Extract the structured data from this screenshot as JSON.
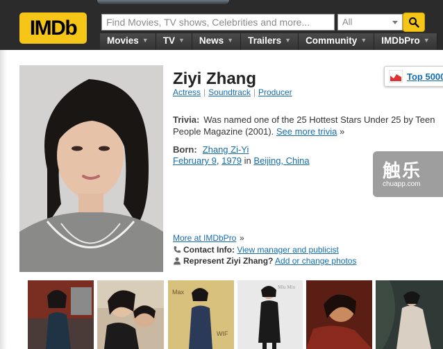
{
  "header": {
    "logo_text": "IMDb",
    "search_placeholder": "Find Movies, TV shows, Celebrities and more...",
    "search_scope": "All",
    "nav": [
      {
        "label": "Movies"
      },
      {
        "label": "TV"
      },
      {
        "label": "News"
      },
      {
        "label": "Trailers"
      },
      {
        "label": "Community"
      },
      {
        "label": "IMDbPro"
      }
    ],
    "accent_color": "#f5c518"
  },
  "profile": {
    "name": "Ziyi Zhang",
    "roles": [
      "Actress",
      "Soundtrack",
      "Producer"
    ],
    "top5000_label": "Top 5000",
    "trivia_label": "Trivia:",
    "trivia_text": "Was named one of the 25 Hottest Stars Under 25 by Teen People Magazine (2001).",
    "trivia_more": "See more trivia",
    "trivia_more_arrow": "»",
    "born_label": "Born:",
    "born_name": "Zhang Zi-Yi",
    "born_date": "February 9",
    "born_year": "1979",
    "born_in": "in",
    "born_place": "Beijing, China",
    "imdbpro_link": "More at IMDbPro",
    "imdbpro_arrow": "»",
    "contact_label": "Contact Info:",
    "contact_link": "View manager and publicist",
    "represent_label": "Represent Ziyi Zhang?",
    "represent_link": "Add or change photos"
  },
  "watermark": {
    "title": "触乐",
    "url": "chuapp.com"
  },
  "thumbnails": [
    {
      "label": "photo-1"
    },
    {
      "label": "photo-2"
    },
    {
      "label": "photo-3"
    },
    {
      "label": "photo-4"
    },
    {
      "label": "photo-5"
    },
    {
      "label": "photo-6"
    }
  ]
}
